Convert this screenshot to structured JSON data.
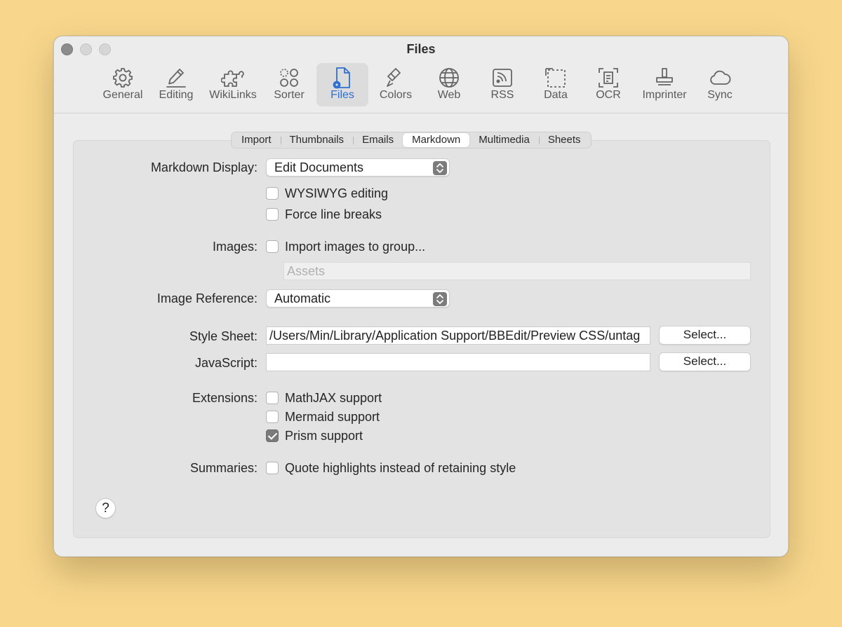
{
  "window": {
    "title": "Files",
    "traffic_lights": [
      "close",
      "minimize",
      "zoom"
    ]
  },
  "toolbar": {
    "items": [
      {
        "label": "General",
        "icon": "gear-icon"
      },
      {
        "label": "Editing",
        "icon": "pencil-icon"
      },
      {
        "label": "WikiLinks",
        "icon": "puzzle-icon"
      },
      {
        "label": "Sorter",
        "icon": "sorter-circles-icon"
      },
      {
        "label": "Files",
        "icon": "file-gear-icon",
        "active": true
      },
      {
        "label": "Colors",
        "icon": "paintbrush-icon"
      },
      {
        "label": "Web",
        "icon": "globe-icon"
      },
      {
        "label": "RSS",
        "icon": "rss-icon"
      },
      {
        "label": "Data",
        "icon": "data-selection-icon"
      },
      {
        "label": "OCR",
        "icon": "ocr-scan-icon"
      },
      {
        "label": "Imprinter",
        "icon": "stamp-icon"
      },
      {
        "label": "Sync",
        "icon": "cloud-icon"
      }
    ],
    "active_color": "#2f6fd0"
  },
  "tabs": {
    "items": [
      "Import",
      "Thumbnails",
      "Emails",
      "Markdown",
      "Multimedia",
      "Sheets"
    ],
    "selected": "Markdown"
  },
  "form": {
    "markdown_display": {
      "label": "Markdown Display:",
      "value": "Edit Documents",
      "options": [
        {
          "label": "WYSIWYG editing",
          "checked": false
        },
        {
          "label": "Force line breaks",
          "checked": false
        }
      ]
    },
    "images": {
      "label": "Images:",
      "checkbox": {
        "label": "Import images to group...",
        "checked": false
      },
      "group_placeholder": "Assets"
    },
    "image_reference": {
      "label": "Image Reference:",
      "value": "Automatic"
    },
    "style_sheet": {
      "label": "Style Sheet:",
      "value": "/Users/Min/Library/Application Support/BBEdit/Preview CSS/untag",
      "button": "Select..."
    },
    "javascript": {
      "label": "JavaScript:",
      "value": "",
      "button": "Select..."
    },
    "extensions": {
      "label": "Extensions:",
      "options": [
        {
          "label": "MathJAX support",
          "checked": false
        },
        {
          "label": "Mermaid support",
          "checked": false
        },
        {
          "label": "Prism support",
          "checked": true
        }
      ]
    },
    "summaries": {
      "label": "Summaries:",
      "checkbox": {
        "label": "Quote highlights instead of retaining style",
        "checked": false
      }
    }
  },
  "help_button": "?"
}
